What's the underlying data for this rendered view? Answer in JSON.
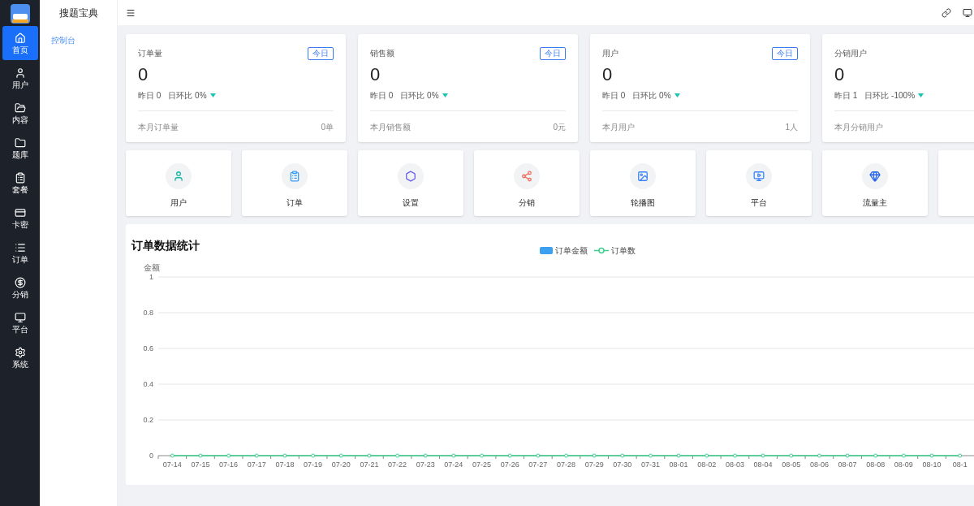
{
  "sidebar": {
    "items": [
      {
        "label": "首页",
        "selected": true
      },
      {
        "label": "用户",
        "selected": false
      },
      {
        "label": "内容",
        "selected": false
      },
      {
        "label": "题库",
        "selected": false
      },
      {
        "label": "套餐",
        "selected": false
      },
      {
        "label": "卡密",
        "selected": false
      },
      {
        "label": "订单",
        "selected": false
      },
      {
        "label": "分销",
        "selected": false
      },
      {
        "label": "平台",
        "selected": false
      },
      {
        "label": "系统",
        "selected": false
      }
    ]
  },
  "submenu": {
    "title": "搜题宝典",
    "items": [
      {
        "label": "控制台",
        "selected": true
      }
    ]
  },
  "stats": [
    {
      "title": "订单量",
      "badge": "今日",
      "value": "0",
      "yesterday": "昨日 0",
      "ratio": "日环比 0%",
      "footer_label": "本月订单量",
      "footer_value": "0单"
    },
    {
      "title": "销售额",
      "badge": "今日",
      "value": "0",
      "yesterday": "昨日 0",
      "ratio": "日环比 0%",
      "footer_label": "本月销售额",
      "footer_value": "0元"
    },
    {
      "title": "用户",
      "badge": "今日",
      "value": "0",
      "yesterday": "昨日 0",
      "ratio": "日环比 0%",
      "footer_label": "本月用户",
      "footer_value": "1人"
    },
    {
      "title": "分销用户",
      "value": "0",
      "yesterday": "昨日 1",
      "ratio": "日环比 -100%",
      "footer_label": "本月分销用户"
    }
  ],
  "shortcuts": [
    {
      "kind": "shortcut",
      "label": "用户"
    },
    {
      "kind": "shortcut",
      "label": "订单"
    },
    {
      "kind": "shortcut",
      "label": "设置"
    },
    {
      "kind": "shortcut",
      "label": "分销"
    },
    {
      "kind": "shortcut",
      "label": "轮播图"
    },
    {
      "kind": "shortcut",
      "label": "平台"
    },
    {
      "kind": "shortcut",
      "label": "流量主"
    },
    {
      "kind": "empty"
    }
  ],
  "chart": {
    "title": "订单数据统计",
    "chart_data": {
      "type": "bar",
      "ylabel": "金额",
      "grid": true,
      "categories": [
        "07-14",
        "07-15",
        "07-16",
        "07-17",
        "07-18",
        "07-19",
        "07-20",
        "07-21",
        "07-22",
        "07-23",
        "07-24",
        "07-25",
        "07-26",
        "07-27",
        "07-28",
        "07-29",
        "07-30",
        "07-31",
        "08-01",
        "08-02",
        "08-03",
        "08-04",
        "08-05",
        "08-06",
        "08-07",
        "08-08",
        "08-09",
        "08-10",
        "08-1"
      ],
      "series": [
        {
          "name": "订单金额",
          "color": "#3ba0f0",
          "values": [
            0,
            0,
            0,
            0,
            0,
            0,
            0,
            0,
            0,
            0,
            0,
            0,
            0,
            0,
            0,
            0,
            0,
            0,
            0,
            0,
            0,
            0,
            0,
            0,
            0,
            0,
            0,
            0,
            0
          ]
        },
        {
          "name": "订单数",
          "color": "#3ecf8e",
          "values": [
            0,
            0,
            0,
            0,
            0,
            0,
            0,
            0,
            0,
            0,
            0,
            0,
            0,
            0,
            0,
            0,
            0,
            0,
            0,
            0,
            0,
            0,
            0,
            0,
            0,
            0,
            0,
            0,
            0
          ]
        }
      ],
      "ylim": [
        0,
        1
      ],
      "yticks": [
        0,
        0.2,
        0.4,
        0.6,
        0.8,
        1
      ]
    }
  }
}
